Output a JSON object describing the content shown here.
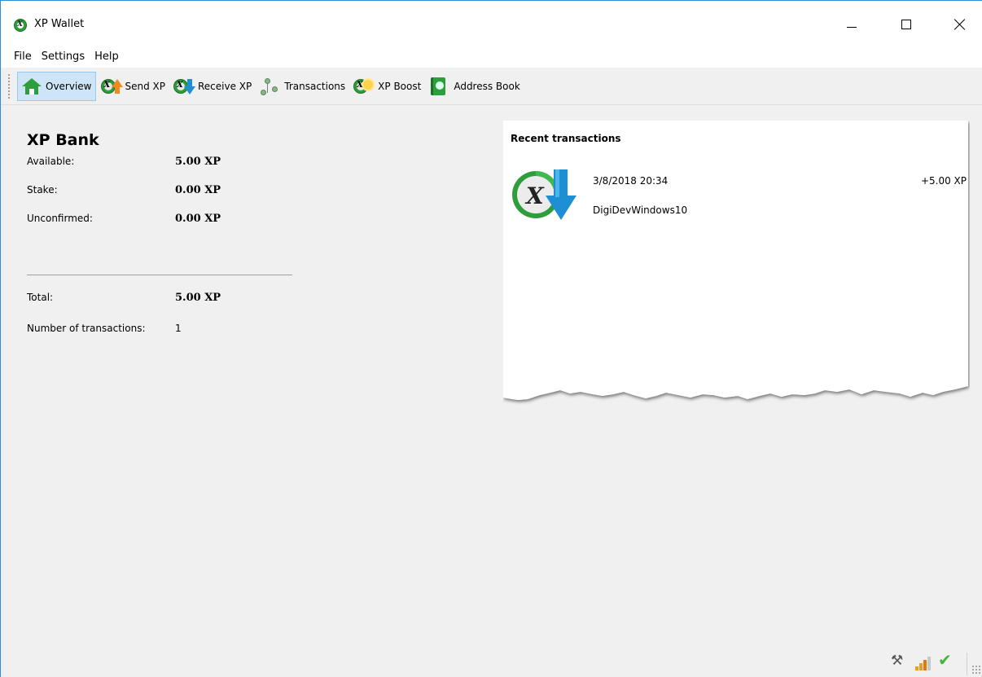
{
  "window": {
    "title": "XP Wallet",
    "icon": "xp-logo-icon"
  },
  "menu": [
    "File",
    "Settings",
    "Help"
  ],
  "toolbar": {
    "items": [
      {
        "label": "Overview",
        "icon": "home-icon",
        "active": true
      },
      {
        "label": "Send XP",
        "icon": "send-xp-icon",
        "active": false
      },
      {
        "label": "Receive XP",
        "icon": "receive-xp-icon",
        "active": false
      },
      {
        "label": "Transactions",
        "icon": "transactions-icon",
        "active": false
      },
      {
        "label": "XP Boost",
        "icon": "xp-boost-icon",
        "active": false
      },
      {
        "label": "Address Book",
        "icon": "address-book-icon",
        "active": false
      }
    ]
  },
  "bank": {
    "title": "XP Bank",
    "available_label": "Available:",
    "available_value": "5.00 XP",
    "stake_label": "Stake:",
    "stake_value": "0.00 XP",
    "unconfirmed_label": "Unconfirmed:",
    "unconfirmed_value": "0.00 XP",
    "total_label": "Total:",
    "total_value": "5.00 XP",
    "count_label": "Number of transactions:",
    "count_value": "1"
  },
  "recent": {
    "title": "Recent transactions",
    "transactions": [
      {
        "date": "3/8/2018 20:34",
        "amount": "+5.00 XP",
        "label": "DigiDevWindows10",
        "icon": "receive-transaction-icon"
      }
    ]
  },
  "status": {
    "icons": [
      "tools-icon",
      "signal-icon",
      "synced-check-icon"
    ]
  },
  "colors": {
    "accent_green": "#2e9e3c",
    "send_orange": "#f08a1c",
    "receive_blue": "#1e8fd2",
    "active_tab_bg": "#cde5f7"
  }
}
